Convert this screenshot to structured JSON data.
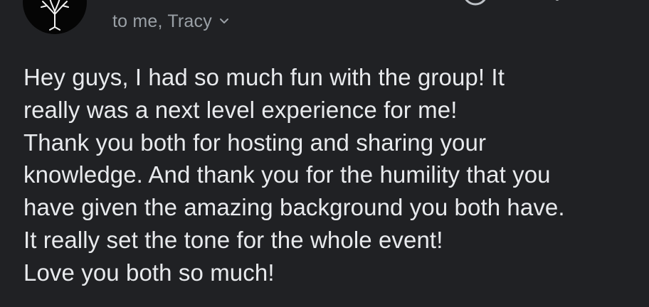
{
  "header": {
    "recipients_text": "to me, Tracy"
  },
  "message": {
    "lines": [
      "Hey guys, I had so much fun with the group! It",
      "really was a next level experience for me!",
      "Thank you both for hosting and sharing your",
      "knowledge. And thank you for the humility that you",
      "have given the amazing background you both have.",
      "It really set the tone for the whole event!",
      "Love you both so much!"
    ]
  },
  "icons": {
    "avatar": "tree-icon",
    "recipients_toggle": "chevron-down-icon",
    "partial_top": "circle-icon",
    "partial_top_right": "more-icon"
  },
  "colors": {
    "background": "#202124",
    "body_text": "#e8eaed",
    "secondary_text": "#9aa0a6",
    "avatar_bg": "#050505"
  }
}
